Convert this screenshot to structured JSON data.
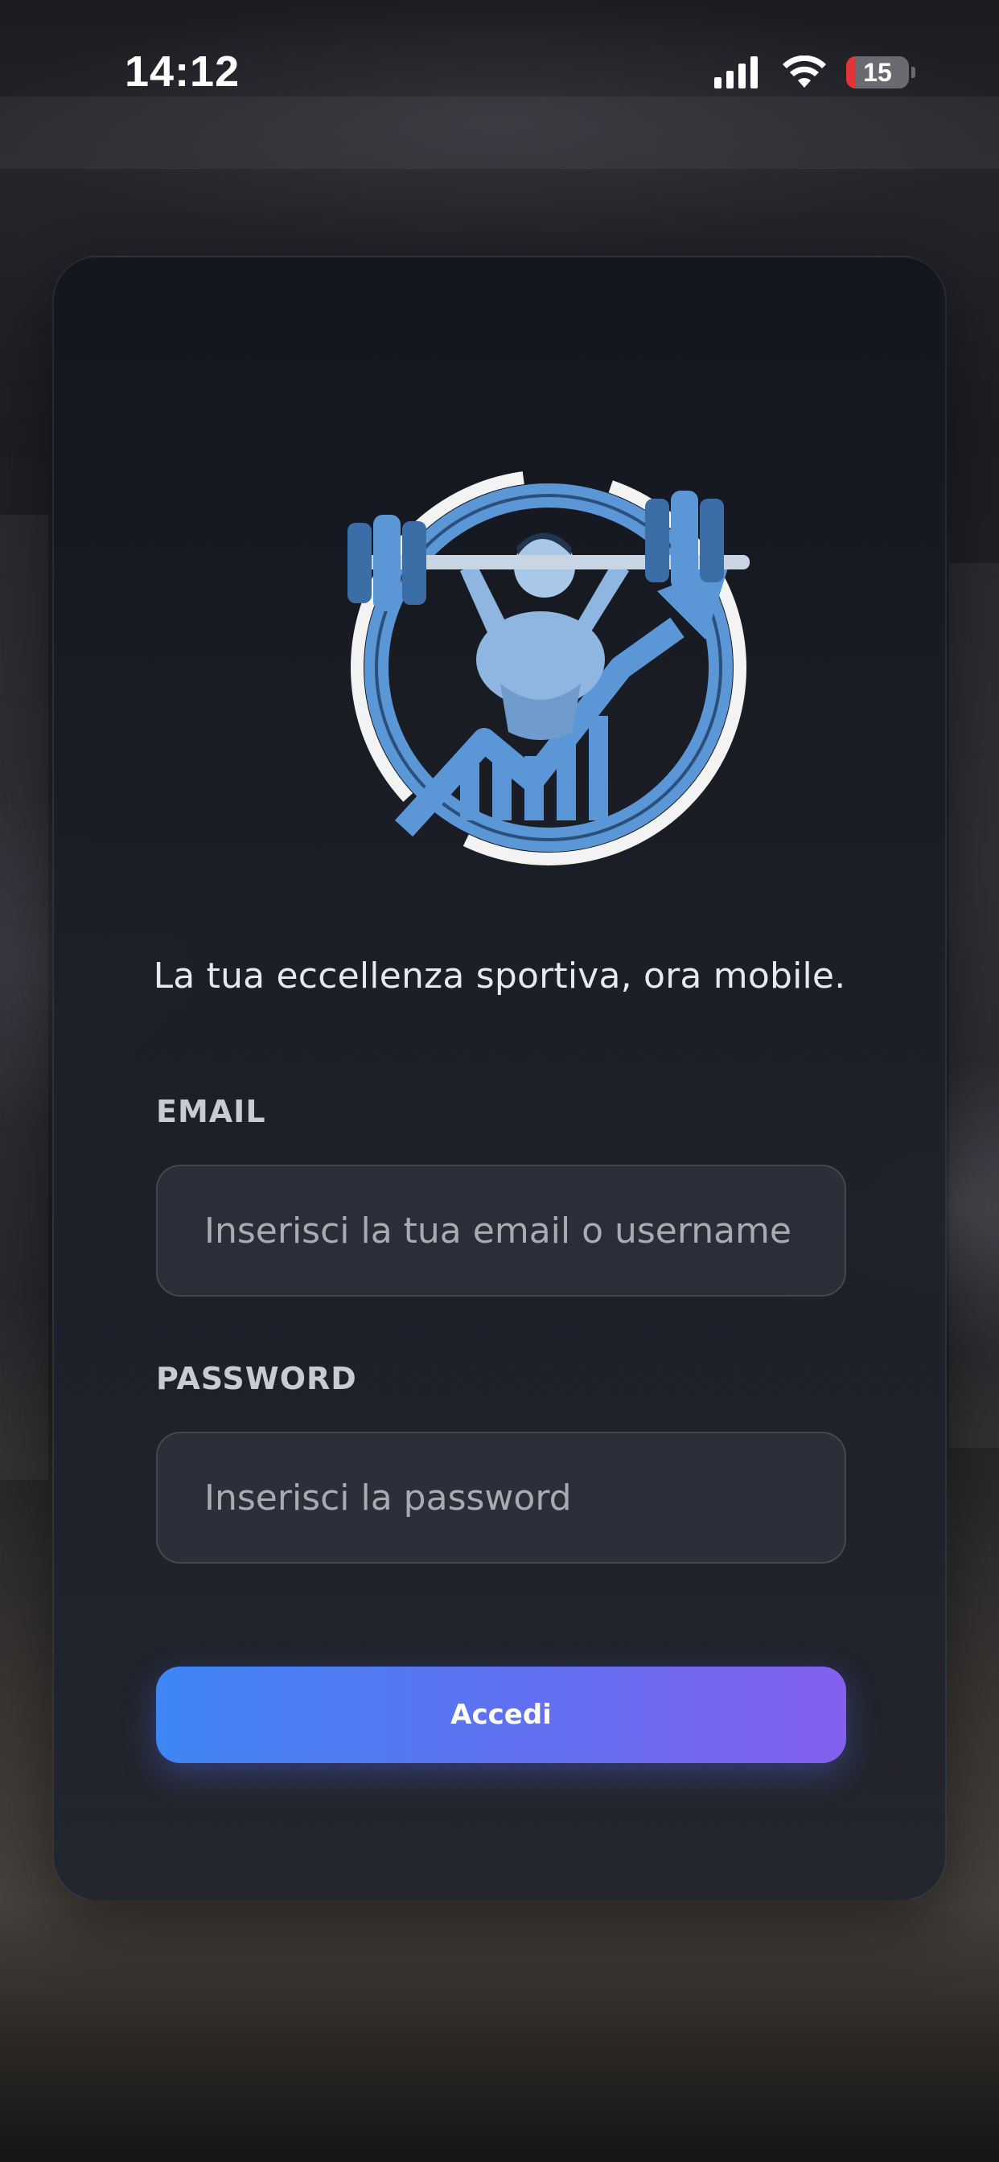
{
  "status_bar": {
    "time": "14:12",
    "battery_level": "15",
    "battery_fraction": 0.15,
    "signal_bars_active": 4,
    "icons": [
      "signal-icon",
      "wifi-icon",
      "battery-icon"
    ],
    "battery_color": "#e5333a"
  },
  "login": {
    "tagline": "La tua eccellenza sportiva, ora mobile.",
    "email_label": "EMAIL",
    "email_placeholder": "Inserisci la tua email o username",
    "email_value": "",
    "password_label": "PASSWORD",
    "password_placeholder": "Inserisci la password",
    "password_value": "",
    "submit_label": "Accedi"
  },
  "colors": {
    "accent_start": "#3f86f5",
    "accent_end": "#8460ef",
    "logo_blue": "#5b97d6"
  }
}
